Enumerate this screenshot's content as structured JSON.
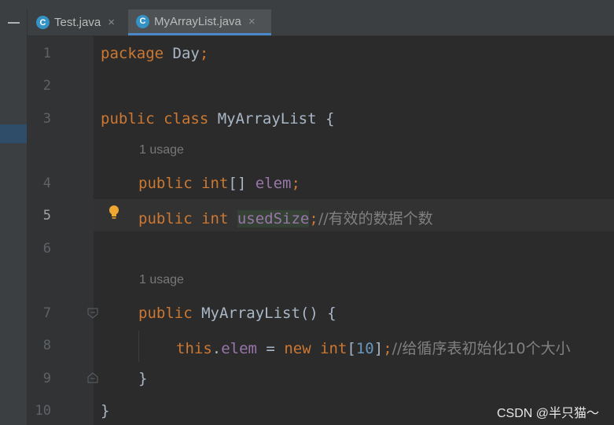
{
  "tabs": [
    {
      "label": "Test.java",
      "icon": "java-class-icon",
      "close": "×",
      "active": false
    },
    {
      "label": "MyArrayList.java",
      "icon": "java-class-icon",
      "close": "×",
      "active": true
    }
  ],
  "class_icon_letter": "C",
  "line_numbers": [
    "1",
    "2",
    "3",
    "4",
    "5",
    "6",
    "7",
    "8",
    "9",
    "10"
  ],
  "current_line": "5",
  "hints": {
    "usage_1": "1 usage",
    "usage_2": "1 usage"
  },
  "code": {
    "l1_kw": "package",
    "l1_rest": " Day",
    "l1_semi": ";",
    "l3_kw": "public class",
    "l3_rest": " MyArrayList {",
    "l4_kw": "public",
    "l4_type": " int",
    "l4_br": "[] ",
    "l4_fld": "elem",
    "l4_semi": ";",
    "l5_kw": "public",
    "l5_type": " int",
    "l5_sp": " ",
    "l5_fld": "usedSize",
    "l5_semi": ";",
    "l5_cmt": "//有效的数据个数",
    "l7_kw": "public",
    "l7_rest": " MyArrayList() {",
    "l8_this": "this",
    "l8_dot": ".",
    "l8_fld": "elem",
    "l8_eq": " = ",
    "l8_new": "new",
    "l8_type": " int",
    "l8_open": "[",
    "l8_num": "10",
    "l8_close": "]",
    "l8_semi": ";",
    "l8_cmt": "//给循序表初始化10个大小",
    "l9": "}",
    "l10": "}"
  },
  "watermark": "CSDN @半只猫～",
  "colors": {
    "keyword": "#cc7832",
    "field": "#9876aa",
    "number": "#6897bb",
    "comment": "#808080",
    "text": "#a9b7c6",
    "background": "#2b2b2b",
    "tab_underline": "#4a88c7"
  }
}
